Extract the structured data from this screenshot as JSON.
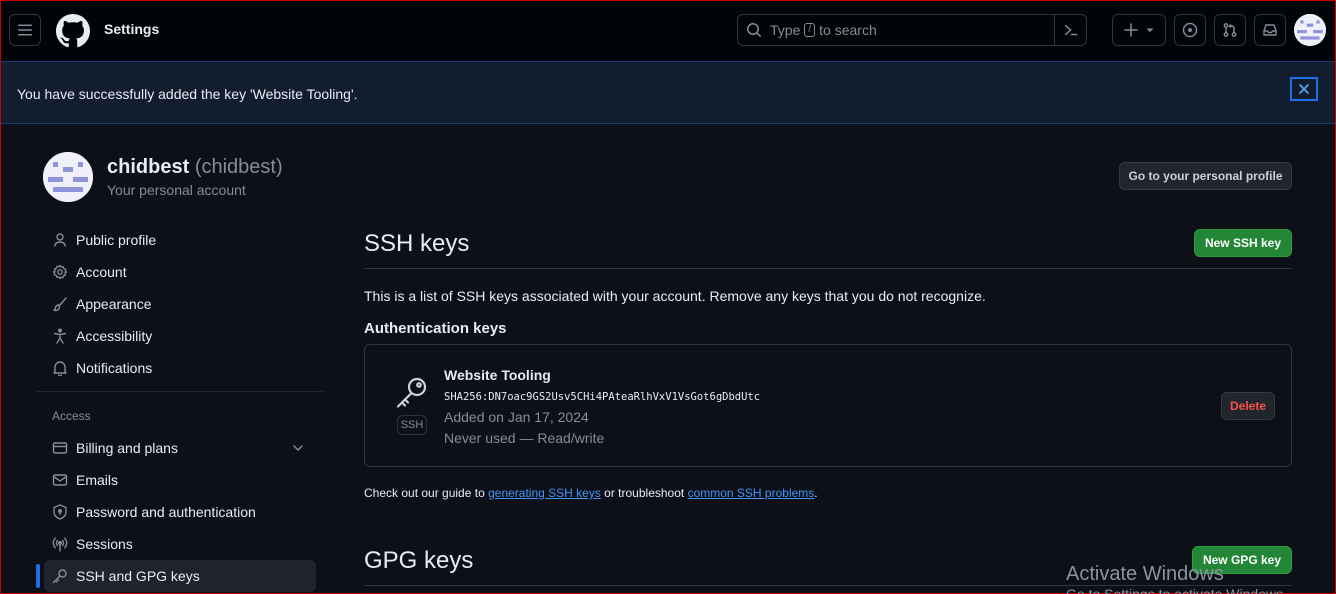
{
  "header": {
    "title": "Settings",
    "search": {
      "pre": "Type",
      "key": "/",
      "post": "to search"
    }
  },
  "flash": {
    "message": "You have successfully added the key 'Website Tooling'.",
    "close": "×"
  },
  "profile": {
    "name": "chidbest",
    "login": "(chidbest)",
    "subtitle": "Your personal account",
    "goto_label": "Go to your personal profile"
  },
  "sidebar": {
    "items": [
      {
        "label": "Public profile",
        "icon": "person-icon"
      },
      {
        "label": "Account",
        "icon": "gear-icon"
      },
      {
        "label": "Appearance",
        "icon": "paintbrush-icon"
      },
      {
        "label": "Accessibility",
        "icon": "accessibility-icon"
      },
      {
        "label": "Notifications",
        "icon": "bell-icon"
      }
    ],
    "section_label": "Access",
    "access_items": [
      {
        "label": "Billing and plans",
        "icon": "credit-card-icon"
      },
      {
        "label": "Emails",
        "icon": "mail-icon"
      },
      {
        "label": "Password and authentication",
        "icon": "shield-lock-icon"
      },
      {
        "label": "Sessions",
        "icon": "broadcast-icon"
      },
      {
        "label": "SSH and GPG keys",
        "icon": "key-icon",
        "active": true
      }
    ]
  },
  "ssh": {
    "title": "SSH keys",
    "new_button": "New SSH key",
    "description": "This is a list of SSH keys associated with your account. Remove any keys that you do not recognize.",
    "auth_heading": "Authentication keys",
    "key": {
      "type_label": "SSH",
      "title": "Website Tooling",
      "fingerprint": "SHA256:DN7oac9GS2Usv5CHi4PAteaRlhVxV1VsGot6gDbdUtc",
      "added": "Added on Jan 17, 2024",
      "usage": "Never used — Read/write",
      "delete_label": "Delete"
    },
    "guide": {
      "pre": "Check out our guide to",
      "link1": "generating SSH keys",
      "mid": "or troubleshoot",
      "link2": "common SSH problems",
      "post": "."
    }
  },
  "gpg": {
    "title": "GPG keys",
    "new_button": "New GPG key"
  },
  "watermark": {
    "line1": "Activate Windows",
    "line2": "Go to Settings to activate Windows."
  },
  "colors": {
    "accent": "#1f6feb",
    "green": "#238636",
    "danger": "#f85149"
  }
}
